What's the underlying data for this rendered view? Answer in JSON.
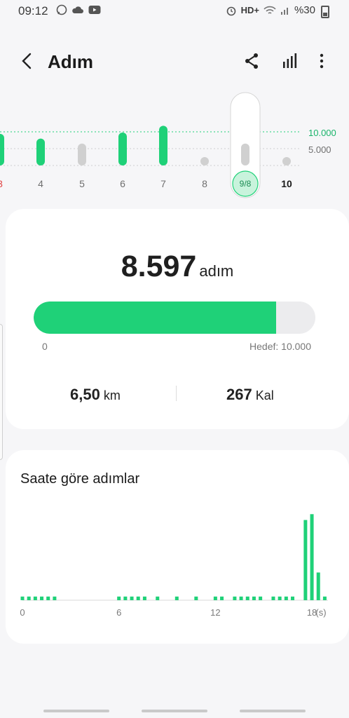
{
  "status": {
    "time": "09:12",
    "hd": "HD+",
    "battery": "%30"
  },
  "header": {
    "title": "Adım"
  },
  "week": {
    "goal_label": "10.000",
    "mid_label": "5.000",
    "days": [
      {
        "label": "3",
        "value": 9400,
        "type": "done",
        "color": "red"
      },
      {
        "label": "4",
        "value": 8000,
        "type": "done"
      },
      {
        "label": "5",
        "value": 6500,
        "type": "partial"
      },
      {
        "label": "6",
        "value": 9800,
        "type": "done"
      },
      {
        "label": "7",
        "value": 11800,
        "type": "done"
      },
      {
        "label": "8",
        "value": 0,
        "type": "none"
      },
      {
        "label": "9/8",
        "value": 6500,
        "type": "selected"
      },
      {
        "label": "10",
        "value": 0,
        "type": "none"
      }
    ]
  },
  "summary": {
    "steps": "8.597",
    "steps_unit": "adım",
    "progress": 0.86,
    "bar_min": "0",
    "bar_goal": "Hedef: 10.000",
    "distance": "6,50",
    "distance_unit": "km",
    "calories": "267",
    "calories_unit": "Kal"
  },
  "hourly": {
    "title": "Saate göre adımlar",
    "axis_labels": [
      "0",
      "6",
      "12",
      "18",
      "(s)"
    ],
    "colors": {
      "accent": "#1fd178",
      "inactive": "#d0d0d0"
    }
  },
  "chart_data": {
    "type": "bar",
    "title": "Saate göre adımlar",
    "xlabel": "(s)",
    "ylabel": "",
    "x_ticks": [
      "0",
      "6",
      "12",
      "18"
    ],
    "series": [
      {
        "values": [
          {
            "x": 0.0,
            "y": 5
          },
          {
            "x": 0.4,
            "y": 5
          },
          {
            "x": 0.8,
            "y": 5
          },
          {
            "x": 1.2,
            "y": 5
          },
          {
            "x": 1.6,
            "y": 5
          },
          {
            "x": 2.0,
            "y": 5
          },
          {
            "x": 6.0,
            "y": 5
          },
          {
            "x": 6.4,
            "y": 5
          },
          {
            "x": 6.8,
            "y": 5
          },
          {
            "x": 7.2,
            "y": 5
          },
          {
            "x": 7.6,
            "y": 5
          },
          {
            "x": 8.4,
            "y": 5
          },
          {
            "x": 9.6,
            "y": 5
          },
          {
            "x": 10.8,
            "y": 5
          },
          {
            "x": 12.0,
            "y": 5
          },
          {
            "x": 12.4,
            "y": 5
          },
          {
            "x": 13.2,
            "y": 5
          },
          {
            "x": 13.6,
            "y": 5
          },
          {
            "x": 14.0,
            "y": 5
          },
          {
            "x": 14.4,
            "y": 5
          },
          {
            "x": 14.8,
            "y": 5
          },
          {
            "x": 15.6,
            "y": 5
          },
          {
            "x": 16.0,
            "y": 5
          },
          {
            "x": 16.4,
            "y": 5
          },
          {
            "x": 16.8,
            "y": 5
          },
          {
            "x": 17.6,
            "y": 110
          },
          {
            "x": 18.0,
            "y": 118
          },
          {
            "x": 18.4,
            "y": 38
          },
          {
            "x": 18.8,
            "y": 5
          }
        ]
      }
    ],
    "ylim": [
      0,
      125
    ]
  }
}
